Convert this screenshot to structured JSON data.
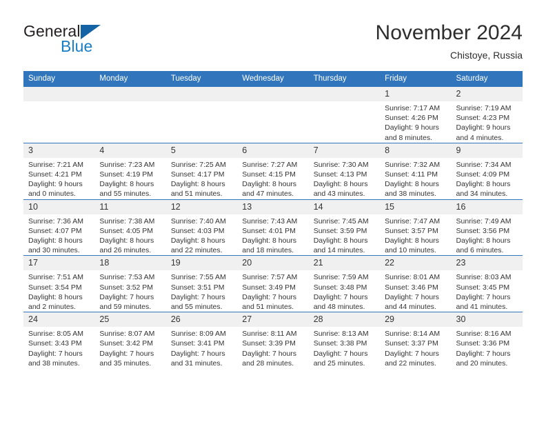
{
  "brand": {
    "name_part1": "General",
    "name_part2": "Blue",
    "triangle_color": "#1464a5"
  },
  "header": {
    "title": "November 2024",
    "subtitle": "Chistoye, Russia"
  },
  "colors": {
    "header_blue": "#3176bc",
    "daynum_band": "#f0f0f0",
    "text": "#333333",
    "brand_blue": "#1a7dc4"
  },
  "labels": {
    "sunrise_prefix": "Sunrise:",
    "sunset_prefix": "Sunset:",
    "daylight_prefix": "Daylight:"
  },
  "weekday_headers": [
    "Sunday",
    "Monday",
    "Tuesday",
    "Wednesday",
    "Thursday",
    "Friday",
    "Saturday"
  ],
  "weeks": [
    [
      {
        "day": "",
        "empty": true
      },
      {
        "day": "",
        "empty": true
      },
      {
        "day": "",
        "empty": true
      },
      {
        "day": "",
        "empty": true
      },
      {
        "day": "",
        "empty": true
      },
      {
        "day": "1",
        "sunrise": "Sunrise: 7:17 AM",
        "sunset": "Sunset: 4:26 PM",
        "daylight_l1": "Daylight: 9 hours",
        "daylight_l2": "and 8 minutes."
      },
      {
        "day": "2",
        "sunrise": "Sunrise: 7:19 AM",
        "sunset": "Sunset: 4:23 PM",
        "daylight_l1": "Daylight: 9 hours",
        "daylight_l2": "and 4 minutes."
      }
    ],
    [
      {
        "day": "3",
        "sunrise": "Sunrise: 7:21 AM",
        "sunset": "Sunset: 4:21 PM",
        "daylight_l1": "Daylight: 9 hours",
        "daylight_l2": "and 0 minutes."
      },
      {
        "day": "4",
        "sunrise": "Sunrise: 7:23 AM",
        "sunset": "Sunset: 4:19 PM",
        "daylight_l1": "Daylight: 8 hours",
        "daylight_l2": "and 55 minutes."
      },
      {
        "day": "5",
        "sunrise": "Sunrise: 7:25 AM",
        "sunset": "Sunset: 4:17 PM",
        "daylight_l1": "Daylight: 8 hours",
        "daylight_l2": "and 51 minutes."
      },
      {
        "day": "6",
        "sunrise": "Sunrise: 7:27 AM",
        "sunset": "Sunset: 4:15 PM",
        "daylight_l1": "Daylight: 8 hours",
        "daylight_l2": "and 47 minutes."
      },
      {
        "day": "7",
        "sunrise": "Sunrise: 7:30 AM",
        "sunset": "Sunset: 4:13 PM",
        "daylight_l1": "Daylight: 8 hours",
        "daylight_l2": "and 43 minutes."
      },
      {
        "day": "8",
        "sunrise": "Sunrise: 7:32 AM",
        "sunset": "Sunset: 4:11 PM",
        "daylight_l1": "Daylight: 8 hours",
        "daylight_l2": "and 38 minutes."
      },
      {
        "day": "9",
        "sunrise": "Sunrise: 7:34 AM",
        "sunset": "Sunset: 4:09 PM",
        "daylight_l1": "Daylight: 8 hours",
        "daylight_l2": "and 34 minutes."
      }
    ],
    [
      {
        "day": "10",
        "sunrise": "Sunrise: 7:36 AM",
        "sunset": "Sunset: 4:07 PM",
        "daylight_l1": "Daylight: 8 hours",
        "daylight_l2": "and 30 minutes."
      },
      {
        "day": "11",
        "sunrise": "Sunrise: 7:38 AM",
        "sunset": "Sunset: 4:05 PM",
        "daylight_l1": "Daylight: 8 hours",
        "daylight_l2": "and 26 minutes."
      },
      {
        "day": "12",
        "sunrise": "Sunrise: 7:40 AM",
        "sunset": "Sunset: 4:03 PM",
        "daylight_l1": "Daylight: 8 hours",
        "daylight_l2": "and 22 minutes."
      },
      {
        "day": "13",
        "sunrise": "Sunrise: 7:43 AM",
        "sunset": "Sunset: 4:01 PM",
        "daylight_l1": "Daylight: 8 hours",
        "daylight_l2": "and 18 minutes."
      },
      {
        "day": "14",
        "sunrise": "Sunrise: 7:45 AM",
        "sunset": "Sunset: 3:59 PM",
        "daylight_l1": "Daylight: 8 hours",
        "daylight_l2": "and 14 minutes."
      },
      {
        "day": "15",
        "sunrise": "Sunrise: 7:47 AM",
        "sunset": "Sunset: 3:57 PM",
        "daylight_l1": "Daylight: 8 hours",
        "daylight_l2": "and 10 minutes."
      },
      {
        "day": "16",
        "sunrise": "Sunrise: 7:49 AM",
        "sunset": "Sunset: 3:56 PM",
        "daylight_l1": "Daylight: 8 hours",
        "daylight_l2": "and 6 minutes."
      }
    ],
    [
      {
        "day": "17",
        "sunrise": "Sunrise: 7:51 AM",
        "sunset": "Sunset: 3:54 PM",
        "daylight_l1": "Daylight: 8 hours",
        "daylight_l2": "and 2 minutes."
      },
      {
        "day": "18",
        "sunrise": "Sunrise: 7:53 AM",
        "sunset": "Sunset: 3:52 PM",
        "daylight_l1": "Daylight: 7 hours",
        "daylight_l2": "and 59 minutes."
      },
      {
        "day": "19",
        "sunrise": "Sunrise: 7:55 AM",
        "sunset": "Sunset: 3:51 PM",
        "daylight_l1": "Daylight: 7 hours",
        "daylight_l2": "and 55 minutes."
      },
      {
        "day": "20",
        "sunrise": "Sunrise: 7:57 AM",
        "sunset": "Sunset: 3:49 PM",
        "daylight_l1": "Daylight: 7 hours",
        "daylight_l2": "and 51 minutes."
      },
      {
        "day": "21",
        "sunrise": "Sunrise: 7:59 AM",
        "sunset": "Sunset: 3:48 PM",
        "daylight_l1": "Daylight: 7 hours",
        "daylight_l2": "and 48 minutes."
      },
      {
        "day": "22",
        "sunrise": "Sunrise: 8:01 AM",
        "sunset": "Sunset: 3:46 PM",
        "daylight_l1": "Daylight: 7 hours",
        "daylight_l2": "and 44 minutes."
      },
      {
        "day": "23",
        "sunrise": "Sunrise: 8:03 AM",
        "sunset": "Sunset: 3:45 PM",
        "daylight_l1": "Daylight: 7 hours",
        "daylight_l2": "and 41 minutes."
      }
    ],
    [
      {
        "day": "24",
        "sunrise": "Sunrise: 8:05 AM",
        "sunset": "Sunset: 3:43 PM",
        "daylight_l1": "Daylight: 7 hours",
        "daylight_l2": "and 38 minutes."
      },
      {
        "day": "25",
        "sunrise": "Sunrise: 8:07 AM",
        "sunset": "Sunset: 3:42 PM",
        "daylight_l1": "Daylight: 7 hours",
        "daylight_l2": "and 35 minutes."
      },
      {
        "day": "26",
        "sunrise": "Sunrise: 8:09 AM",
        "sunset": "Sunset: 3:41 PM",
        "daylight_l1": "Daylight: 7 hours",
        "daylight_l2": "and 31 minutes."
      },
      {
        "day": "27",
        "sunrise": "Sunrise: 8:11 AM",
        "sunset": "Sunset: 3:39 PM",
        "daylight_l1": "Daylight: 7 hours",
        "daylight_l2": "and 28 minutes."
      },
      {
        "day": "28",
        "sunrise": "Sunrise: 8:13 AM",
        "sunset": "Sunset: 3:38 PM",
        "daylight_l1": "Daylight: 7 hours",
        "daylight_l2": "and 25 minutes."
      },
      {
        "day": "29",
        "sunrise": "Sunrise: 8:14 AM",
        "sunset": "Sunset: 3:37 PM",
        "daylight_l1": "Daylight: 7 hours",
        "daylight_l2": "and 22 minutes."
      },
      {
        "day": "30",
        "sunrise": "Sunrise: 8:16 AM",
        "sunset": "Sunset: 3:36 PM",
        "daylight_l1": "Daylight: 7 hours",
        "daylight_l2": "and 20 minutes."
      }
    ]
  ]
}
